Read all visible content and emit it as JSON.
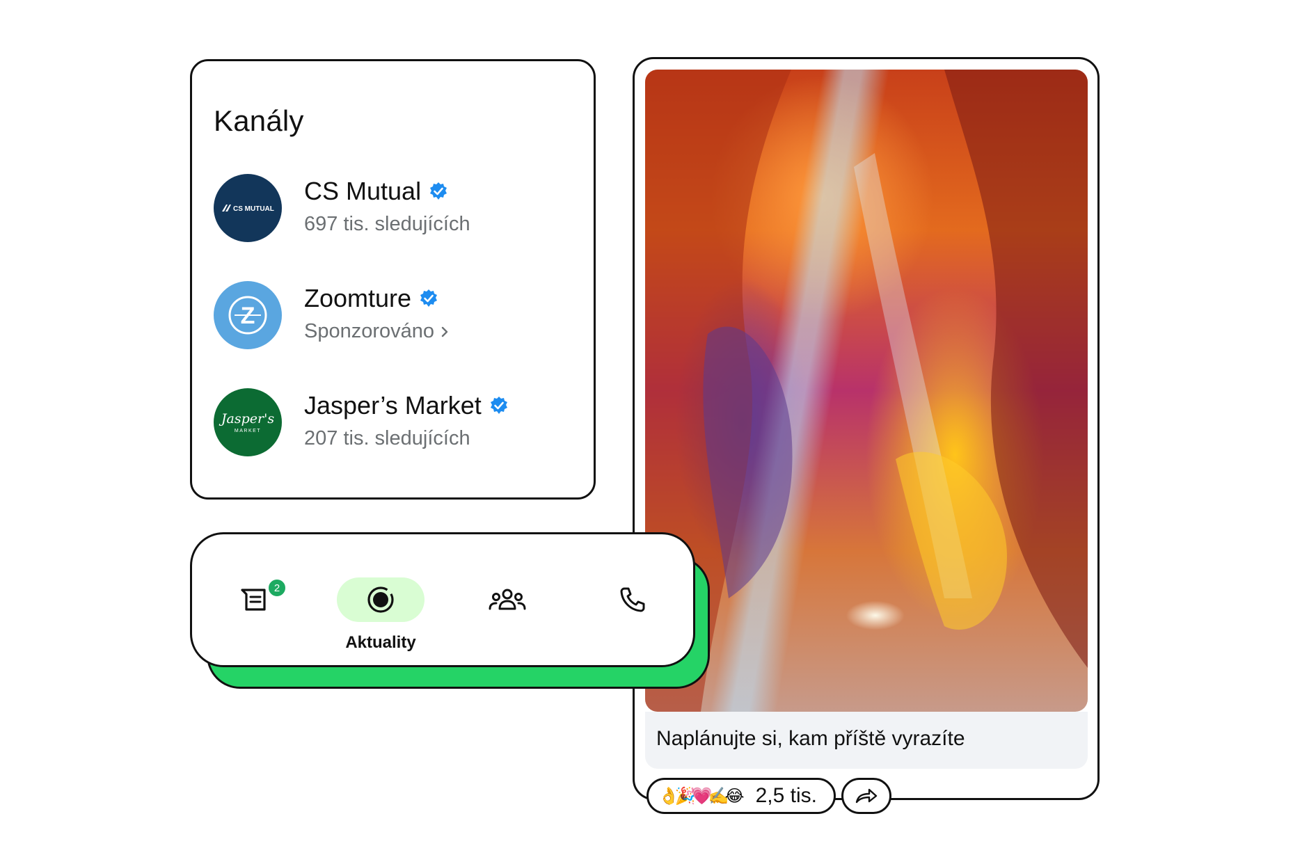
{
  "channels": {
    "title": "Kanály",
    "items": [
      {
        "name": "CS Mutual",
        "subtitle": "697 tis. sledujících",
        "avatar_text": "CS MUTUAL",
        "avatar_color": "#12365a",
        "verified": true
      },
      {
        "name": "Zoomture",
        "subtitle": "Sponzorováno",
        "avatar_text": "Z",
        "avatar_color": "#5aa6e0",
        "verified": true,
        "subtitle_icon": "chevron-right-icon"
      },
      {
        "name": "Jasper’s Market",
        "subtitle": "207 tis. sledujících",
        "avatar_text": "Jasper's",
        "avatar_subtext": "MARKET",
        "avatar_color": "#0c6b33",
        "verified": true
      }
    ]
  },
  "nav": {
    "chats_badge": "2",
    "active_label": "Aktuality",
    "items": [
      {
        "icon": "chats-icon"
      },
      {
        "icon": "updates-icon",
        "label": "Aktuality",
        "active": true
      },
      {
        "icon": "communities-icon"
      },
      {
        "icon": "calls-icon"
      }
    ],
    "accent_color": "#25d366",
    "active_bg": "#d9fdd3"
  },
  "post": {
    "caption": "Naplánujte si, kam příště vyrazíte",
    "reaction_emojis": "👌🎉💗✍️😂",
    "reaction_count": "2,5 tis.",
    "share_icon": "forward-icon"
  },
  "colors": {
    "verified": "#1d8cf0",
    "subtitle": "#6b6f72"
  }
}
